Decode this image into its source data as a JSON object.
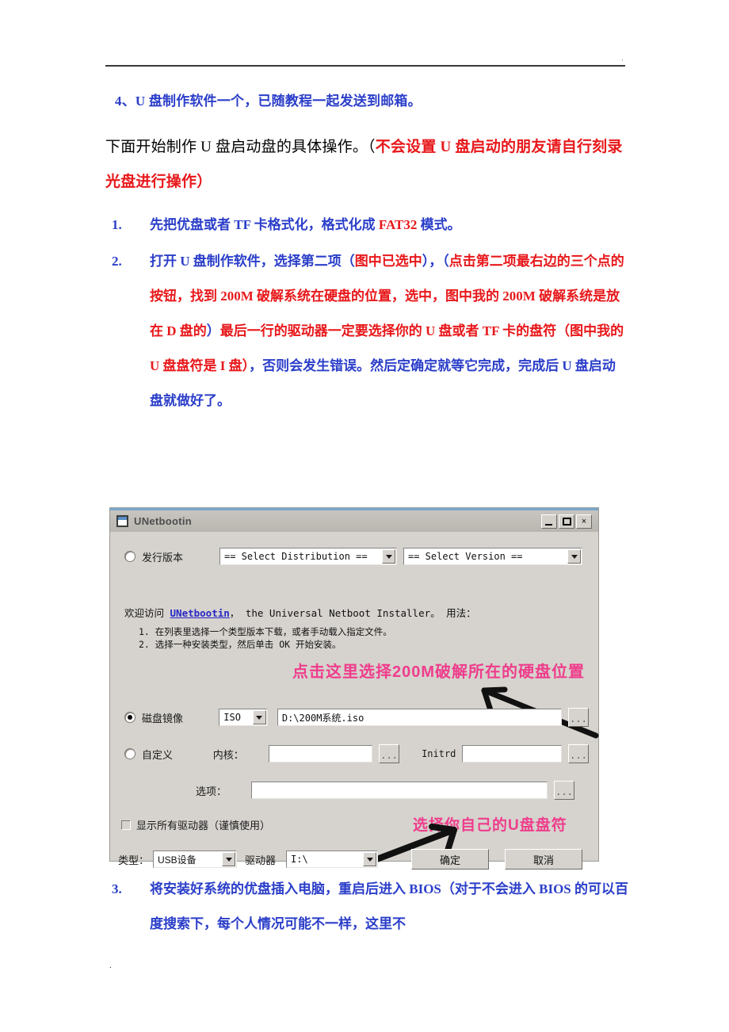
{
  "page": {
    "header_mark": "·",
    "footer_mark": "."
  },
  "document": {
    "item4": "4、U 盘制作软件一个，已随教程一起发送到邮箱。",
    "lead": {
      "black_a": "下面开始制作 U 盘启动盘的具体操作。（",
      "red": "不会设置 U 盘启动的朋友请自行刻录光盘进行操作）"
    },
    "steps": [
      {
        "num": "1.",
        "segments": [
          {
            "text": "先把优盘或者 TF 卡格式化，格式化成 ",
            "color": "blue"
          },
          {
            "text": "FAT32",
            "color": "red"
          },
          {
            "text": " 模式。",
            "color": "blue"
          }
        ]
      },
      {
        "num": "2.",
        "segments": [
          {
            "text": "打开 U 盘制作软件，选择第二项（",
            "color": "blue"
          },
          {
            "text": "图中已选中",
            "color": "red"
          },
          {
            "text": "），（",
            "color": "blue"
          },
          {
            "text": "点击第二项最右边的三个点的按钮，找到 200M 破解系统在硬盘的位置，选中，图中我的 200M 破解系统是放在 D 盘的",
            "color": "red"
          },
          {
            "text": "）",
            "color": "blue"
          },
          {
            "text": "最后一行的驱动器一定要选择你的 U 盘或者 TF 卡的盘符（图中我的 U 盘盘符是 I 盘）",
            "color": "red"
          },
          {
            "text": "，否则会发生错误。然后定确定就等它完成，完成后 U 盘启动盘就做好了。",
            "color": "blue"
          }
        ]
      },
      {
        "num": "3.",
        "segments": [
          {
            "text": "将安装好系统的优盘插入电脑，重启后进入 BIOS（对于不会进入 BIOS 的可以百度搜索下，每个人情况可能不一样，这里不",
            "color": "blue"
          }
        ]
      }
    ]
  },
  "dialog": {
    "title": "UNetbootin",
    "titlebar_buttons": {
      "minimize": "minimize-icon",
      "maximize": "maximize-icon",
      "close": "×"
    },
    "distribution_row": {
      "radio_label": "发行版本",
      "radio_selected": false,
      "distribution_value": "== Select Distribution ==",
      "version_value": "== Select Version =="
    },
    "welcome": {
      "prefix": "欢迎访问 ",
      "link": "UNetbootin",
      "suffix": "， the Universal Netboot Installer。 用法："
    },
    "howto": [
      "1. 在列表里选择一个类型版本下载，或者手动载入指定文件。",
      "2. 选择一种安装类型，然后单击 OK 开始安装。"
    ],
    "diskimage_row": {
      "radio_label": "磁盘镜像",
      "radio_selected": true,
      "type_value": "ISO",
      "path_value": "D:\\200M系统.iso",
      "browse_label": "..."
    },
    "custom_row": {
      "radio_label": "自定义",
      "radio_selected": false,
      "kernel_label": "内核：",
      "kernel_value": "",
      "kernel_browse": "...",
      "initrd_label": "Initrd",
      "initrd_value": "",
      "initrd_browse": "..."
    },
    "options_row": {
      "label": "选项：",
      "value": "",
      "browse": "..."
    },
    "show_all_drives": {
      "label": "显示所有驱动器（谨慎使用）",
      "checked": false
    },
    "bottom_row": {
      "type_label": "类型：",
      "type_value": "USB设备",
      "drive_label": "驱动器",
      "drive_value": "I:\\",
      "ok_label": "确定",
      "cancel_label": "取消"
    },
    "annotations": [
      {
        "text": "点击这里选择200M破解所在的硬盘位置",
        "color": "#ef3d8c"
      },
      {
        "text": "选择你自己的U盘盘符",
        "color": "#ef3d8c"
      }
    ]
  },
  "colors": {
    "blue_text": "#2b3ec9",
    "red_text": "#e8181b",
    "annotation_pink": "#ef3d8c",
    "dialog_face": "#d6d3ce",
    "link_blue": "#2626c8"
  }
}
